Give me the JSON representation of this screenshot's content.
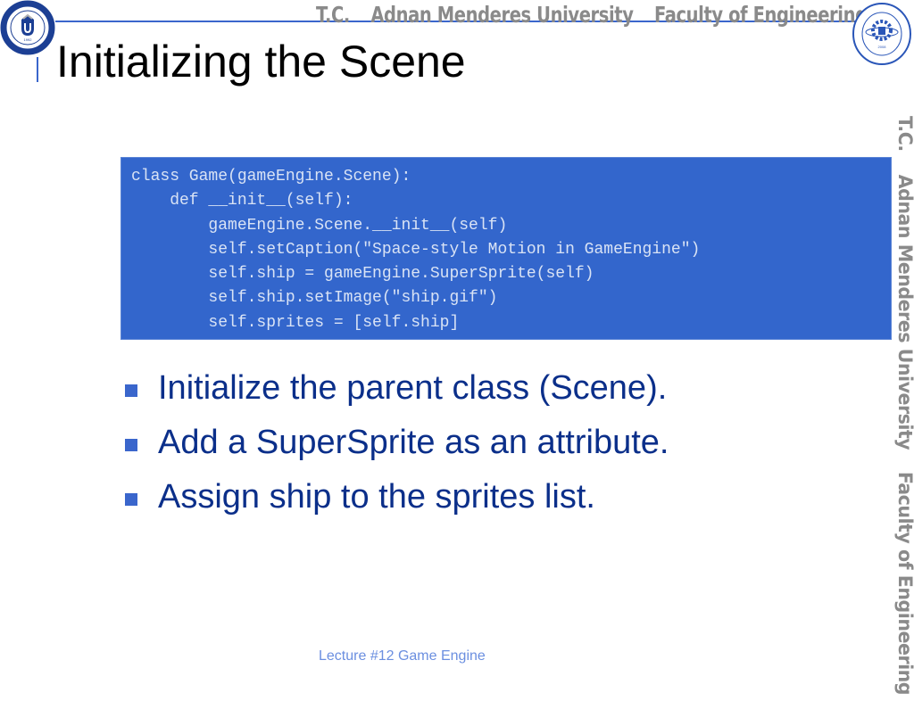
{
  "header": {
    "banner": [
      "T.C.",
      "Adnan Menderes University",
      "Faculty of Engineering"
    ],
    "left_logo": {
      "icon": "university-seal-icon",
      "ring_text": "ADNAN MENDERES ÜNİVERSİTESİ",
      "year": "1992"
    },
    "right_logo": {
      "icon": "engineering-faculty-seal-icon",
      "ring_text_top": "ADNAN MENDERES UNIVERSITY",
      "ring_text_bottom": "ENGINEERING FACULTY",
      "year": "2008"
    },
    "accent_color": "#3a66cc"
  },
  "side_banner": [
    "T.C.",
    "Adnan Menderes University",
    "Faculty of Engineering"
  ],
  "slide": {
    "title": "Initializing the Scene",
    "code": {
      "background_color": "#3366cc",
      "lines": [
        "class Game(gameEngine.Scene):",
        "    def __init__(self):",
        "        gameEngine.Scene.__init__(self)",
        "        self.setCaption(\"Space-style Motion in GameEngine\")",
        "        self.ship = gameEngine.SuperSprite(self)",
        "        self.ship.setImage(\"ship.gif\")",
        "        self.sprites = [self.ship]"
      ]
    },
    "bullets": [
      "Initialize the parent class (Scene).",
      "Add a SuperSprite as an attribute.",
      "Assign ship to the sprites list."
    ]
  },
  "footer": {
    "text": "Lecture #12 Game Engine"
  }
}
